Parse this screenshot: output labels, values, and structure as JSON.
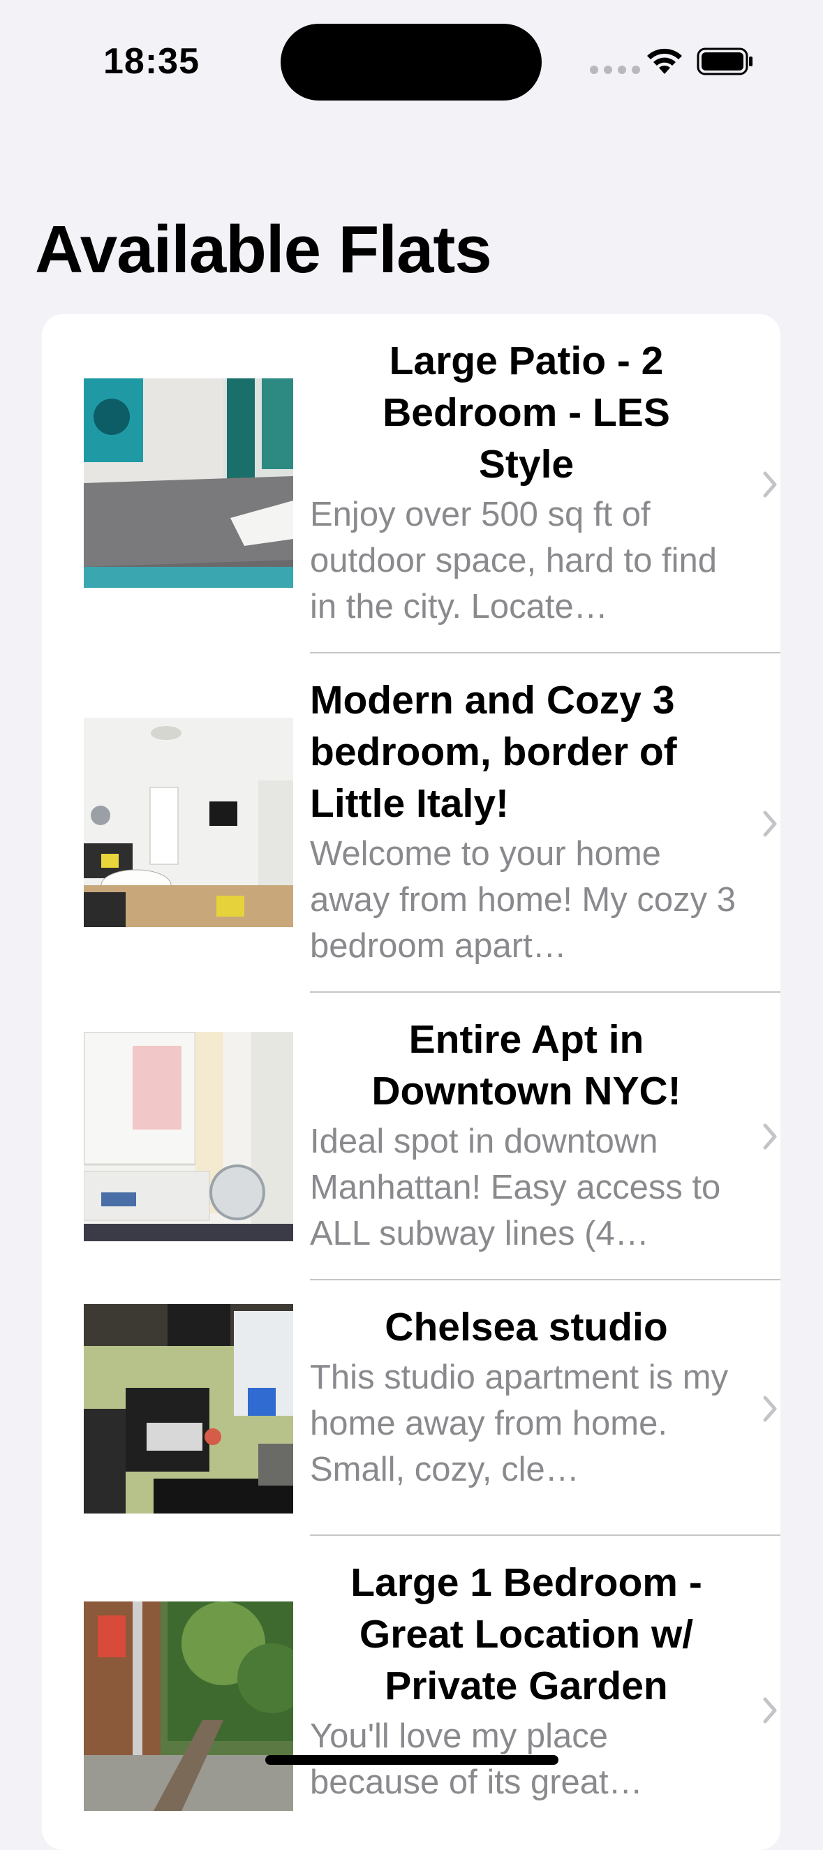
{
  "status_bar": {
    "time": "18:35"
  },
  "page": {
    "title": "Available Flats"
  },
  "listings": [
    {
      "title": "Large Patio - 2 Bedroom - LES Style",
      "description": "Enjoy over 500 sq ft of outdoor space, hard to find in the city. Locate…",
      "photo": "bedroom-photo"
    },
    {
      "title": "Modern and Cozy 3 bedroom, border of Little Italy!",
      "description": "Welcome to your home away from home! My cozy 3 bedroom apart…",
      "photo": "living-room-photo"
    },
    {
      "title": "Entire Apt in Downtown NYC!",
      "description": "Ideal spot in downtown Manhattan! Easy access to ALL subway lines (4…",
      "photo": "window-fan-photo"
    },
    {
      "title": "Chelsea studio",
      "description": "This studio apartment is my home away from home. Small, cozy, cle…",
      "photo": "studio-photo"
    },
    {
      "title": "Large 1 Bedroom - Great Location w/ Private Garden",
      "description": "You'll love my place because of its great…",
      "photo": "garden-photo"
    }
  ],
  "colors": {
    "background": "#f2f2f7",
    "card": "#ffffff",
    "secondary_text": "#8a8a8e",
    "chevron": "#c4c4c7"
  }
}
